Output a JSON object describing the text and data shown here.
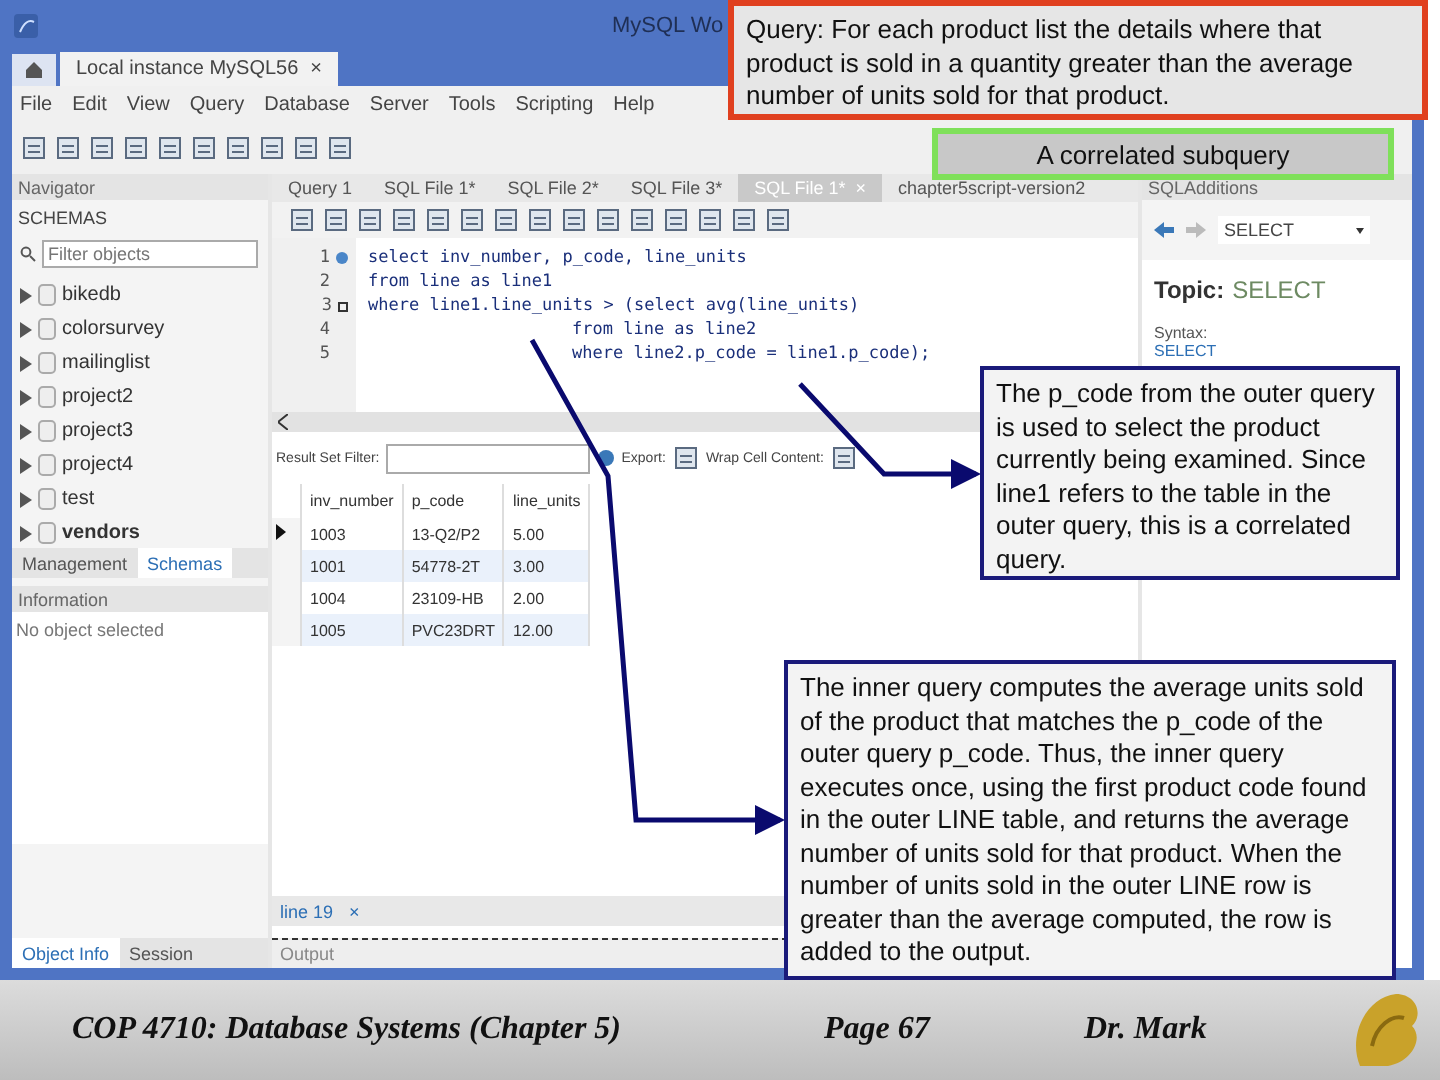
{
  "window": {
    "title": "MySQL Wo"
  },
  "connection_tab": {
    "label": "Local instance MySQL56",
    "close": "×"
  },
  "menu": [
    "File",
    "Edit",
    "View",
    "Query",
    "Database",
    "Server",
    "Tools",
    "Scripting",
    "Help"
  ],
  "navigator": {
    "title": "Navigator",
    "section": "SCHEMAS",
    "filter": {
      "placeholder": "Filter objects"
    },
    "schemas": [
      {
        "name": "bikedb",
        "selected": false
      },
      {
        "name": "colorsurvey",
        "selected": false
      },
      {
        "name": "mailinglist",
        "selected": false
      },
      {
        "name": "project2",
        "selected": false
      },
      {
        "name": "project3",
        "selected": false
      },
      {
        "name": "project4",
        "selected": false
      },
      {
        "name": "test",
        "selected": false
      },
      {
        "name": "vendors",
        "selected": true
      }
    ],
    "tabs": [
      {
        "label": "Management",
        "selected": false
      },
      {
        "label": "Schemas",
        "selected": true
      }
    ]
  },
  "information": {
    "title": "Information",
    "message": "No object selected",
    "tabs": [
      {
        "label": "Object Info",
        "selected": true
      },
      {
        "label": "Session",
        "selected": false
      }
    ]
  },
  "editor_tabs": [
    {
      "label": "Query 1",
      "selected": false
    },
    {
      "label": "SQL File 1*",
      "selected": false
    },
    {
      "label": "SQL File 2*",
      "selected": false
    },
    {
      "label": "SQL File 3*",
      "selected": false
    },
    {
      "label": "SQL File 1*",
      "selected": true,
      "close": "×"
    },
    {
      "label": "chapter5script-version2",
      "selected": false
    }
  ],
  "code": {
    "lines": [
      {
        "number": "1",
        "text": "select inv_number, p_code, line_units",
        "kind": "statement"
      },
      {
        "number": "2",
        "text": "from line as line1",
        "kind": "plain"
      },
      {
        "number": "3",
        "text": "where line1.line_units > (select avg(line_units)",
        "kind": "fold"
      },
      {
        "number": "4",
        "text": "from line as line2",
        "kind": "continued"
      },
      {
        "number": "5",
        "text": "where line2.p_code = line1.p_code);",
        "kind": "continued"
      }
    ]
  },
  "result": {
    "filter_label": "Result Set Filter:",
    "export_label": "Export:",
    "wrap_label": "Wrap Cell Content:",
    "columns": [
      "inv_number",
      "p_code",
      "line_units"
    ],
    "rows": [
      {
        "cells": [
          "1003",
          "13-Q2/P2",
          "5.00"
        ],
        "selected": true
      },
      {
        "cells": [
          "1001",
          "54778-2T",
          "3.00"
        ],
        "selected": false
      },
      {
        "cells": [
          "1004",
          "23109-HB",
          "2.00"
        ],
        "selected": false
      },
      {
        "cells": [
          "1005",
          "PVC23DRT",
          "12.00"
        ],
        "selected": false
      }
    ]
  },
  "output": {
    "tab": "line 19",
    "close": "×",
    "title": "Output"
  },
  "sql_additions": {
    "title": "SQLAdditions",
    "dropdown": "SELECT",
    "topic_label": "Topic:",
    "topic": "SELECT",
    "syntax_label": "Syntax:",
    "syntax": "SELECT"
  },
  "callouts": [
    {
      "kind": "question",
      "text": "Query: For each product list the details where that product is sold in a quantity greater than the average number of units sold for that product."
    },
    {
      "kind": "label",
      "text": "A correlated subquery"
    },
    {
      "kind": "note",
      "text": "The p_code from the outer query is used to select the product currently being examined.  Since line1 refers to the table in the outer query, this is a correlated query."
    },
    {
      "kind": "note",
      "text": "The inner query computes the average units sold of the product that matches the p_code of the outer query p_code. Thus, the inner query executes once, using the first product code found in the outer LINE table, and returns the average number of units sold for that product. When the number of units sold in the outer LINE row is greater than the average computed, the row is added to the output."
    }
  ],
  "footer": {
    "course": "COP 4710: Database Systems  (Chapter 5)",
    "page": "Page 67",
    "author": "Dr. Mark"
  }
}
